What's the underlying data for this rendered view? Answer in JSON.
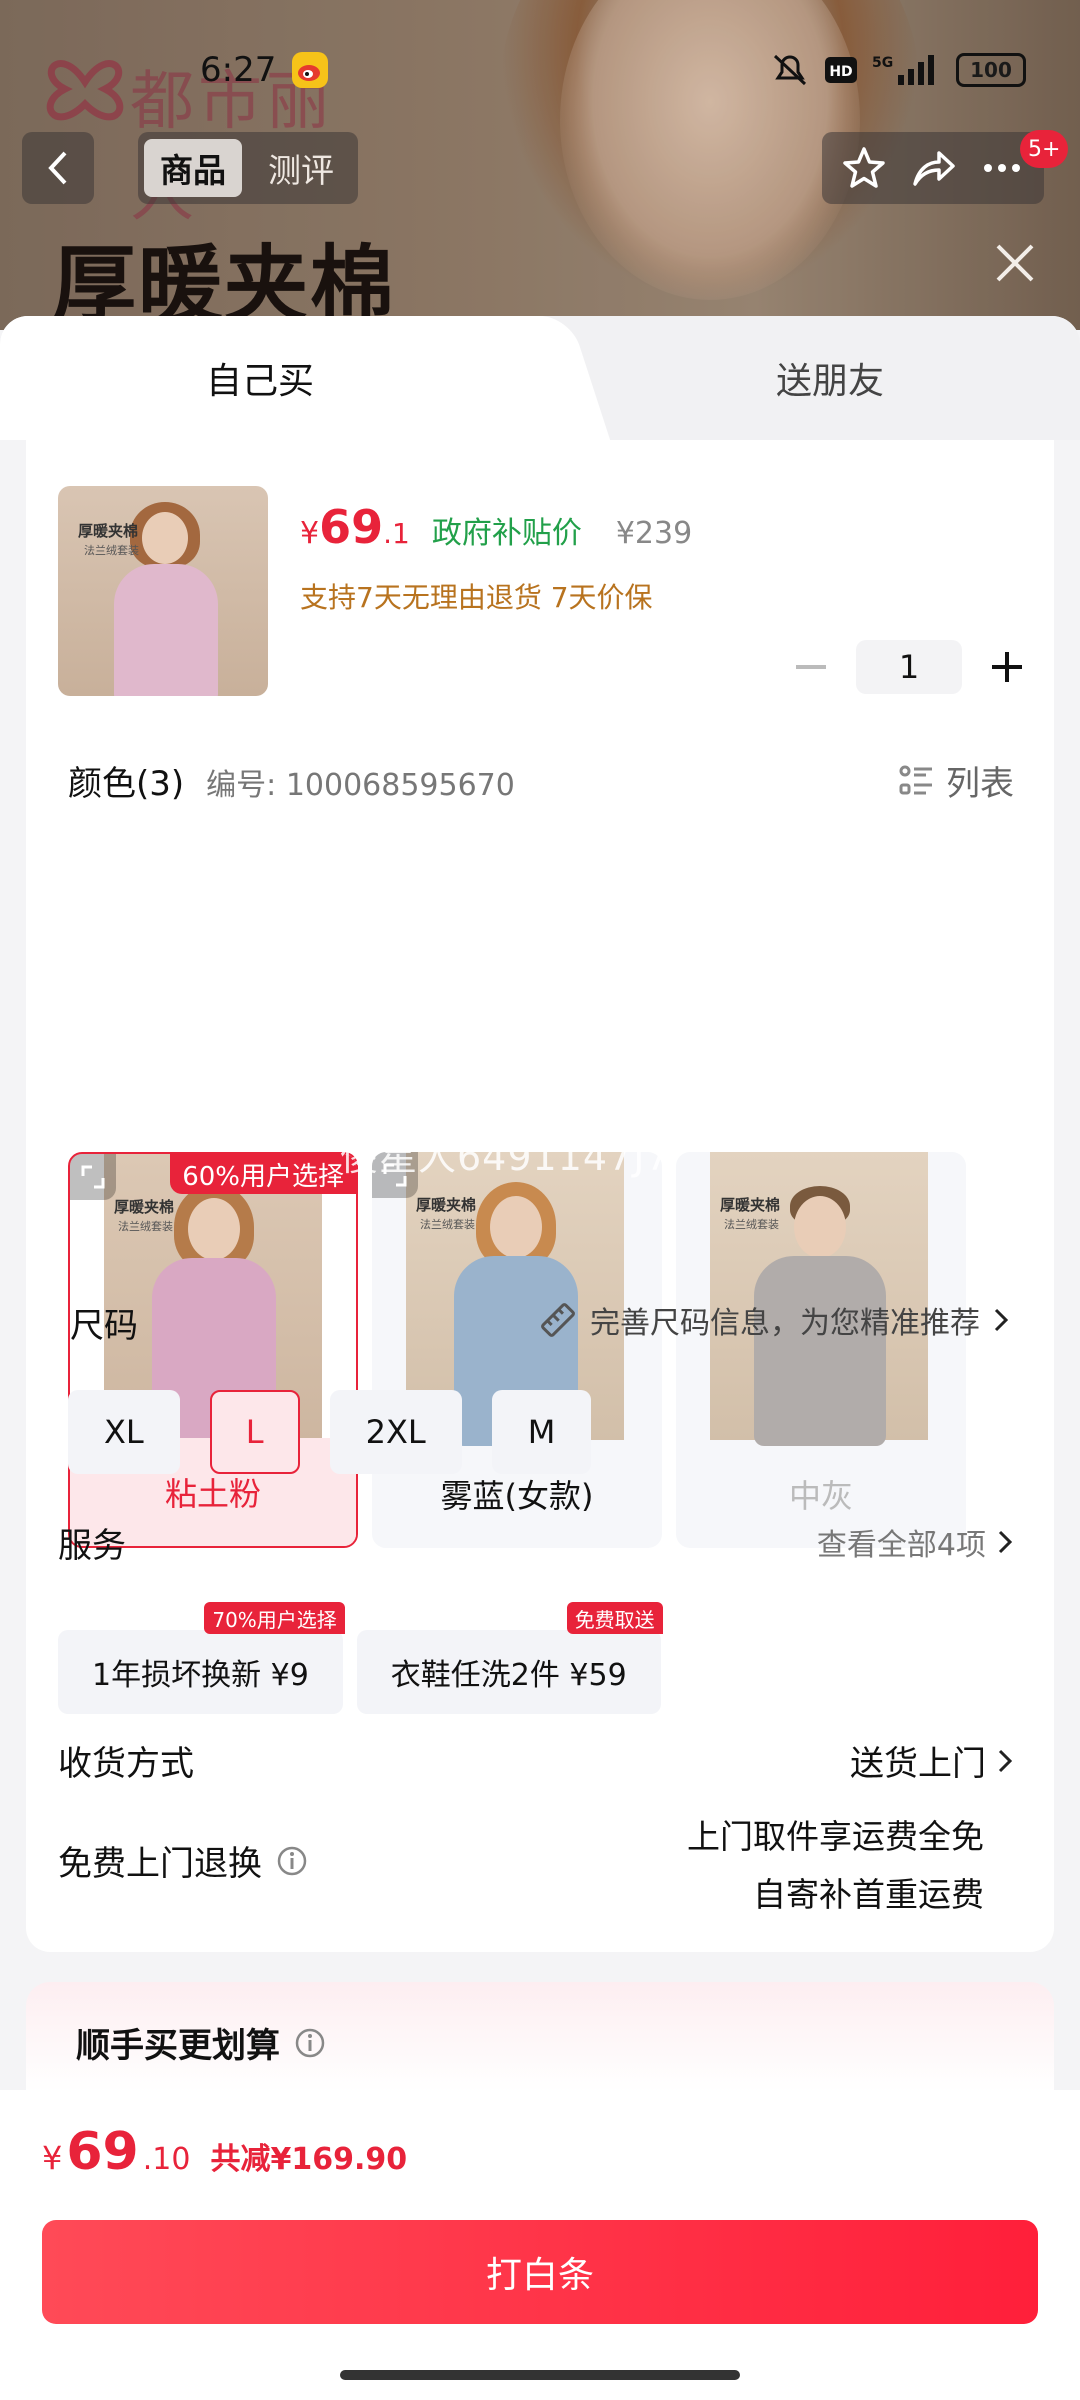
{
  "status": {
    "time": "6:27",
    "battery": "100",
    "network": "5G"
  },
  "nav": {
    "tabs": [
      {
        "label": "商品"
      },
      {
        "label": "测评"
      }
    ],
    "badge": "5+"
  },
  "background": {
    "headline": "厚暖夹棉",
    "brand": "都市丽人"
  },
  "sheet": {
    "tabs": {
      "self": "自己买",
      "friend": "送朋友"
    }
  },
  "product": {
    "thumb_title": "厚暖夹棉",
    "thumb_sub": "法兰绒套装",
    "price_symbol": "¥",
    "price_main": "69",
    "price_decimal": ".1",
    "price_tag": "政府补贴价",
    "original_price": "¥239",
    "promise": "支持7天无理由退货  7天价保",
    "quantity": "1"
  },
  "colors": {
    "title": "颜色(3)",
    "code": "编号: 100068595670",
    "list_label": "列表",
    "options": [
      {
        "label": "粘土粉",
        "badge": "60%用户选择",
        "img_title": "厚暖夹棉",
        "img_sub": "法兰绒套装"
      },
      {
        "label": "雾蓝(女款)",
        "img_title": "厚暖夹棉",
        "img_sub": "法兰绒套装"
      },
      {
        "label": "中灰",
        "img_title": "厚暖夹棉",
        "img_sub": "法兰绒套装"
      }
    ]
  },
  "sizes": {
    "title": "尺码",
    "hint": "完善尺码信息，为您精准推荐",
    "options": [
      "XL",
      "L",
      "2XL",
      "M"
    ],
    "selected": "L"
  },
  "services": {
    "title": "服务",
    "view_all": "查看全部4项",
    "items": [
      {
        "label": "1年损坏换新  ¥9",
        "badge": "70%用户选择"
      },
      {
        "label": "衣鞋任洗2件  ¥59",
        "badge": "免费取送"
      }
    ]
  },
  "shipping": {
    "title": "收货方式",
    "value": "送货上门"
  },
  "returns": {
    "title": "免费上门退换",
    "line1": "上门取件享运费全免",
    "line2": "自寄补首重运费"
  },
  "bundle": {
    "title": "顺手买更划算"
  },
  "watermark": "傻星人6491147J7",
  "footer": {
    "symbol": "¥",
    "total_main": "69",
    "total_decimal": ".10",
    "saving": "共减¥169.90",
    "button": "打白条"
  },
  "colors_theme": {
    "accent": "#e8233a",
    "green": "#22a04a",
    "gold": "#b8731f"
  }
}
